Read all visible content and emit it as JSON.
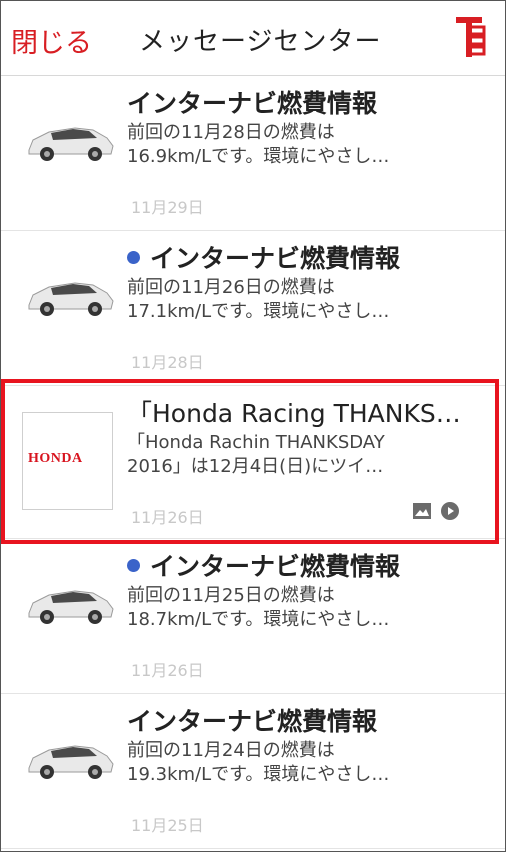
{
  "header": {
    "close_label": "閉じる",
    "title": "メッセージセンター"
  },
  "messages": [
    {
      "title": "インターナビ燃費情報",
      "unread": false,
      "body_line1": "前回の11月28日の燃費は",
      "body_line2": "16.9km/Lです。環境にやさし…",
      "date": "11月29日"
    },
    {
      "title": "インターナビ燃費情報",
      "unread": true,
      "body_line1": "前回の11月26日の燃費は",
      "body_line2": "17.1km/Lです。環境にやさし…",
      "date": "11月28日"
    },
    {
      "title": "「Honda Racing THANKS…",
      "unread": false,
      "body_line1": "「Honda Rachin THANKSDAY",
      "body_line2": "2016」は12月4日(日)にツイ…",
      "date": "11月26日",
      "logo": "HONDA"
    },
    {
      "title": "インターナビ燃費情報",
      "unread": true,
      "body_line1": "前回の11月25日の燃費は",
      "body_line2": "18.7km/Lです。環境にやさし…",
      "date": "11月26日"
    },
    {
      "title": "インターナビ燃費情報",
      "unread": false,
      "body_line1": "前回の11月24日の燃費は",
      "body_line2": "19.3km/Lです。環境にやさし…",
      "date": "11月25日"
    }
  ],
  "colors": {
    "accent": "#d81e23",
    "unread_dot": "#3a63c9",
    "highlight_border": "#e8141f"
  }
}
